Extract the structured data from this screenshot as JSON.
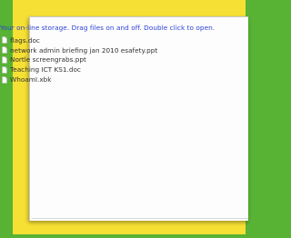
{
  "storage": {
    "heading": "Your on-line storage. Drag files on and off. Double click to open."
  },
  "files": [
    {
      "name": "flags.doc",
      "icon": "document-icon"
    },
    {
      "name": "network admin briefing jan 2010 esafety.ppt",
      "icon": "document-icon"
    },
    {
      "name": "Nortle screengrabs.ppt",
      "icon": "document-icon"
    },
    {
      "name": "Teaching ICT KS1.doc",
      "icon": "document-icon"
    },
    {
      "name": "WhoamI.xbk",
      "icon": "document-icon"
    }
  ],
  "colors": {
    "background": "#58b234",
    "frame": "#f6e034",
    "heading": "#2a3fd6",
    "file_text": "#333333"
  }
}
